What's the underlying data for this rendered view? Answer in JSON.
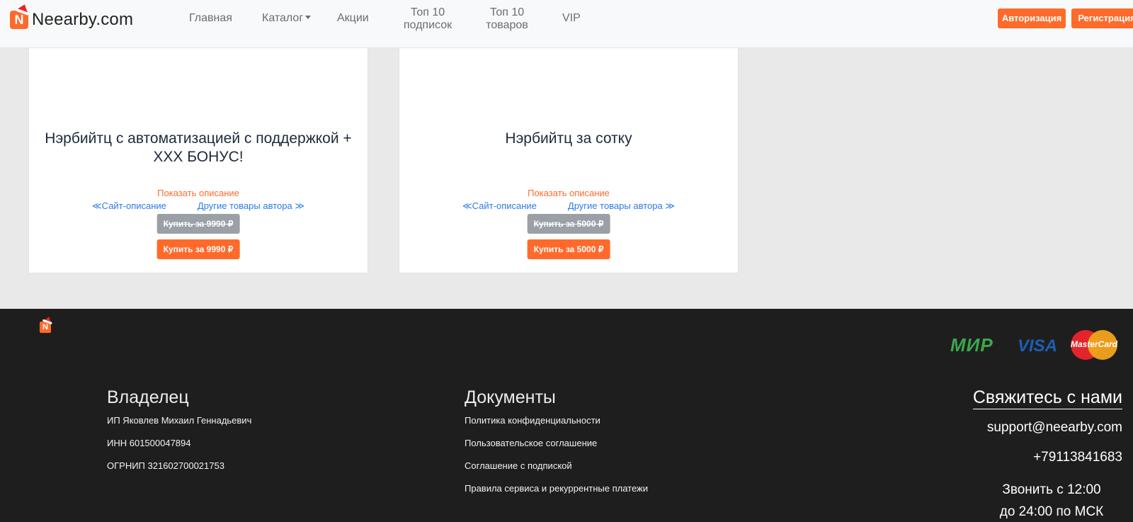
{
  "header": {
    "logo_text": "Neearby.com",
    "logo_letter": "N",
    "nav": {
      "home": "Главная",
      "catalog": "Каталог",
      "promos": "Акции",
      "top_subs_line1": "Топ 10",
      "top_subs_line2": "подписок",
      "top_goods_line1": "Топ 10",
      "top_goods_line2": "товаров",
      "vip": "VIP"
    },
    "login_label": "Авторизация",
    "register_label": "Регистрация"
  },
  "products": [
    {
      "title": "Нэрбийтц с автоматизацией с поддержкой + XXX БОНУС!",
      "show_description": "Показать описание",
      "site_description_link": "≪Сайт-описание",
      "author_link": "Другие товары автора ≫",
      "old_price_label": "Купить за 9990 ₽",
      "buy_label": "Купить за 9990 ₽"
    },
    {
      "title": "Нэрбийтц за сотку",
      "show_description": "Показать описание",
      "site_description_link": "≪Сайт-описание",
      "author_link": "Другие товары автора ≫",
      "old_price_label": "Купить за 5000 ₽",
      "buy_label": "Купить за 5000 ₽"
    }
  ],
  "footer": {
    "logo_letter": "N",
    "payment": {
      "mir": "МИР",
      "visa": "VISA",
      "mastercard": "MasterCard"
    },
    "owner": {
      "heading": "Владелец",
      "name": "ИП Яковлев Михаил Геннадьевич",
      "inn": "ИНН 601500047894",
      "ogrnip": "ОГРНИП 321602700021753"
    },
    "documents": {
      "heading": "Документы",
      "privacy": "Политика конфиденциальности",
      "user_agreement": "Пользовательское соглашение",
      "subscription_agreement": "Соглашение с подпиской",
      "service_rules": "Правила сервиса и рекуррентные платежи"
    },
    "contact": {
      "heading": "Свяжитесь с нами",
      "email": "support@neearby.com",
      "phone": "+79113841683",
      "hours_line1": "Звонить с 12:00",
      "hours_line2": "до 24:00 по МСК"
    }
  },
  "colors": {
    "accent": "#ff6a2b",
    "link": "#2c7be5",
    "footer_bg": "#1f1e1f",
    "page_bg": "#e9e9e9",
    "disabled_button": "#9aa0a6"
  }
}
